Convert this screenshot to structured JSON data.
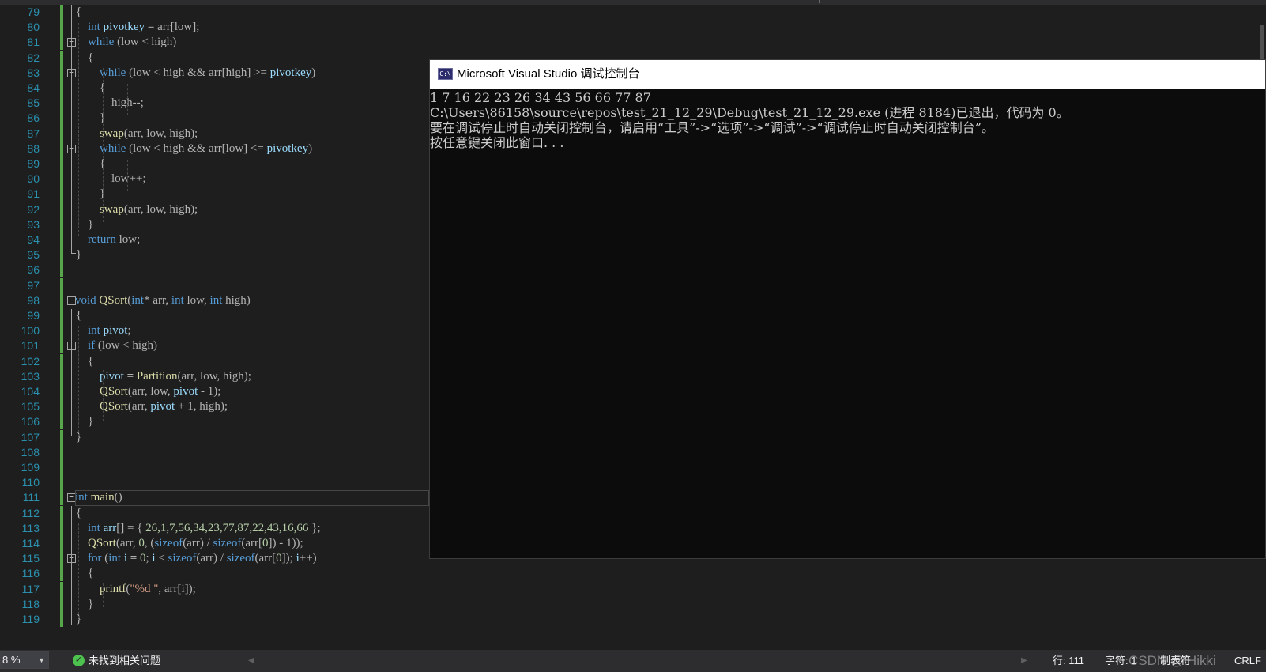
{
  "editor": {
    "line_numbers": [
      "79",
      "80",
      "81",
      "82",
      "83",
      "84",
      "85",
      "86",
      "87",
      "88",
      "89",
      "90",
      "91",
      "92",
      "93",
      "94",
      "95",
      "96",
      "97",
      "98",
      "99",
      "100",
      "101",
      "102",
      "103",
      "104",
      "105",
      "106",
      "107",
      "108",
      "109",
      "110",
      "111",
      "112",
      "113",
      "114",
      "115",
      "116",
      "117",
      "118",
      "119"
    ]
  },
  "console": {
    "icon_label": "C:\\",
    "title": "Microsoft Visual Studio 调试控制台",
    "lines": [
      "1 7 16 22 23 26 34 43 56 66 77 87",
      "C:\\Users\\86158\\source\\repos\\test_21_12_29\\Debug\\test_21_12_29.exe (进程 8184)已退出，代码为 0。",
      "要在调试停止时自动关闭控制台，请启用“工具”->“选项”->“调试”->“调试停止时自动关闭控制台”。",
      "按任意键关闭此窗口. . ."
    ]
  },
  "statusbar": {
    "zoom": "8 %",
    "issues": "未找到相关问题",
    "row": "行: 111",
    "col": "字符: 1",
    "tabs": "制表符",
    "eol": "CRLF",
    "watermark": "CSDN @iHikki"
  },
  "colors": {
    "background": "#1e1e1e",
    "keyword": "#569cd6",
    "function": "#dcdcaa",
    "variable": "#9cdcfe",
    "number": "#b5cea8",
    "line_number": "#2b91af",
    "gutter_changed": "#57a64a"
  },
  "icons": {
    "console_icon": "console-app-icon",
    "issues_icon": "check-circle-icon",
    "fold_icon": "collapse-minus-icon"
  }
}
